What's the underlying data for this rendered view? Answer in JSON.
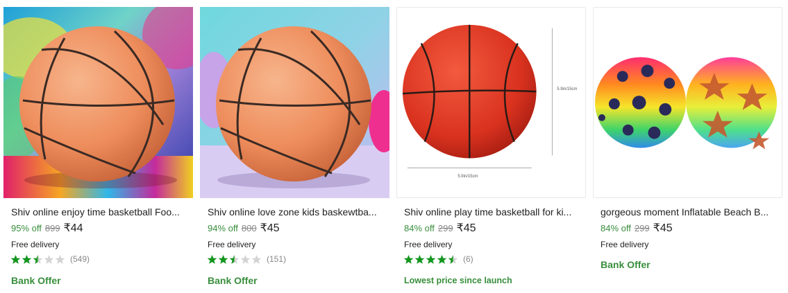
{
  "products": [
    {
      "title": "Shiv online enjoy time basketball Foo...",
      "discount": "95% off",
      "mrp": "899",
      "price": "₹44",
      "delivery": "Free delivery",
      "rating": 2.5,
      "reviews": "(549)",
      "offer": "Bank Offer",
      "image": "basketball-on-colorful-paint-icon"
    },
    {
      "title": "Shiv online love zone kids baskewtba...",
      "discount": "94% off",
      "mrp": "800",
      "price": "₹45",
      "delivery": "Free delivery",
      "rating": 2.5,
      "reviews": "(151)",
      "offer": "Bank Offer",
      "image": "basketball-on-pastel-background-icon"
    },
    {
      "title": "Shiv online play time basketball for ki...",
      "discount": "84% off",
      "mrp": "299",
      "price": "₹45",
      "delivery": "Free delivery",
      "rating": 4.5,
      "reviews": "(6)",
      "offer": "Lowest price since launch",
      "image": "red-basketball-with-dimensions-icon",
      "dim_height": "5.9in/15cm",
      "dim_width": "5.9in/15cm"
    },
    {
      "title": "gorgeous moment Inflatable Beach B...",
      "discount": "84% off",
      "mrp": "299",
      "price": "₹45",
      "delivery": "Free delivery",
      "offer": "Bank Offer",
      "image": "rainbow-beach-balls-icon"
    }
  ],
  "colors": {
    "discount_green": "#388e3c",
    "star_filled": "#14961f",
    "star_empty": "#d4d4d4",
    "muted": "#878787"
  }
}
